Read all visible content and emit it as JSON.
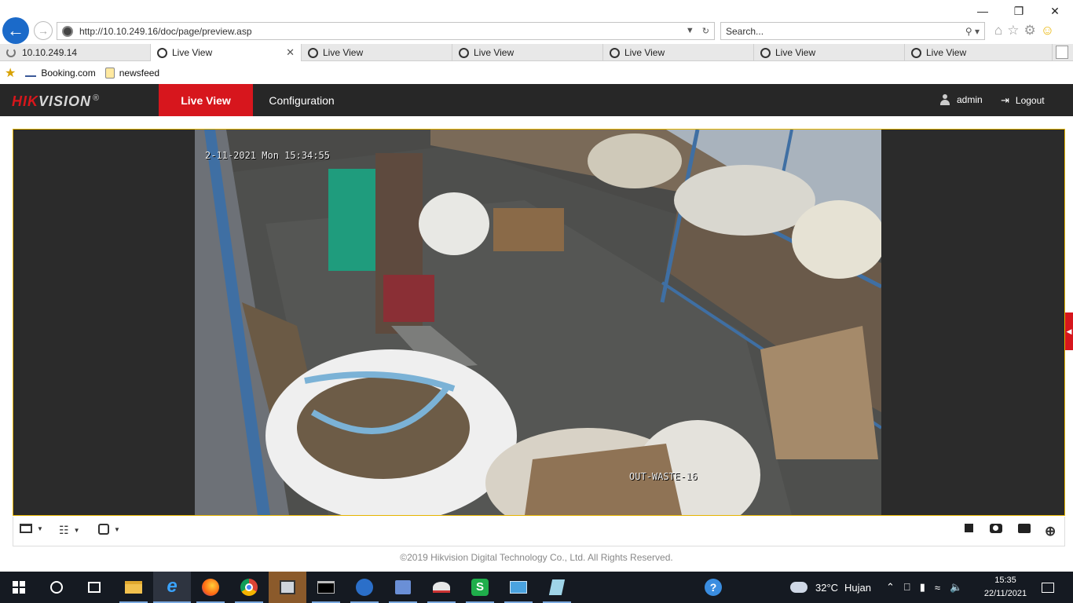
{
  "browser": {
    "url": "http://10.10.249.16/doc/page/preview.asp",
    "search_placeholder": "Search...",
    "tabs": [
      {
        "label": "10.10.249.14",
        "loading": true
      },
      {
        "label": "Live View",
        "active": true
      },
      {
        "label": "Live View"
      },
      {
        "label": "Live View"
      },
      {
        "label": "Live View"
      },
      {
        "label": "Live View"
      },
      {
        "label": "Live View"
      }
    ],
    "favorites": [
      {
        "label": "Booking.com"
      },
      {
        "label": "newsfeed"
      }
    ],
    "window_controls": [
      "minimize",
      "restore",
      "close"
    ]
  },
  "app": {
    "logo": {
      "part1": "HIK",
      "part2": "VISION",
      "reg": "®"
    },
    "nav": {
      "live_view": "Live View",
      "configuration": "Configuration"
    },
    "user": {
      "name": "admin",
      "logout": "Logout"
    },
    "camera": {
      "timestamp": "2-11-2021 Mon 15:34:55",
      "channel_name": "OUT-WASTE-16"
    },
    "controls_left": [
      "window-layout-icon",
      "stream-type-icon",
      "plugin-icon"
    ],
    "controls_right": [
      "stop-all-icon",
      "capture-icon",
      "record-icon",
      "digital-zoom-icon"
    ],
    "copyright": "©2019 Hikvision Digital Technology Co., Ltd. All Rights Reserved.",
    "accent": "#d7161d"
  },
  "taskbar": {
    "weather": {
      "temp": "32°C",
      "condition": "Hujan"
    },
    "time": "15:35",
    "date": "22/11/2021"
  }
}
